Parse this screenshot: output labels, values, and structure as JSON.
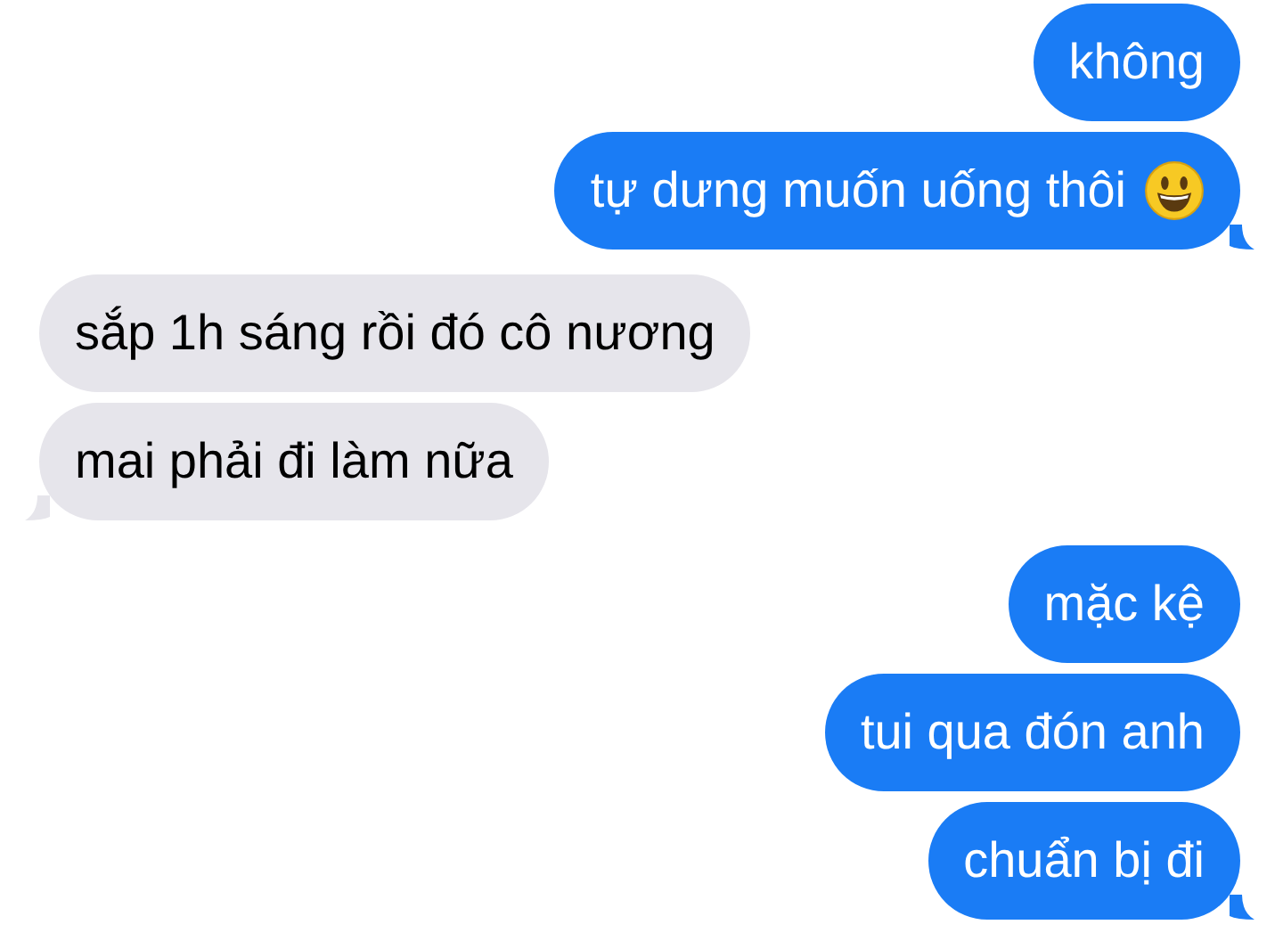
{
  "messages": [
    {
      "kind": "sent",
      "text": "không",
      "tail": false
    },
    {
      "kind": "sent",
      "text": "tự dưng muốn uống thôi",
      "trailing_icon": true,
      "tail": true
    },
    {
      "kind": "received",
      "text": "sắp 1h sáng rồi đó cô nương",
      "tail": false
    },
    {
      "kind": "received",
      "text": "mai phải đi làm nữa",
      "tail": true
    },
    {
      "kind": "sent",
      "text": "mặc kệ",
      "tail": false
    },
    {
      "kind": "sent",
      "text": "tui qua đón anh",
      "tail": false
    },
    {
      "kind": "sent",
      "text": "chuẩn bị đi",
      "tail": true
    }
  ]
}
